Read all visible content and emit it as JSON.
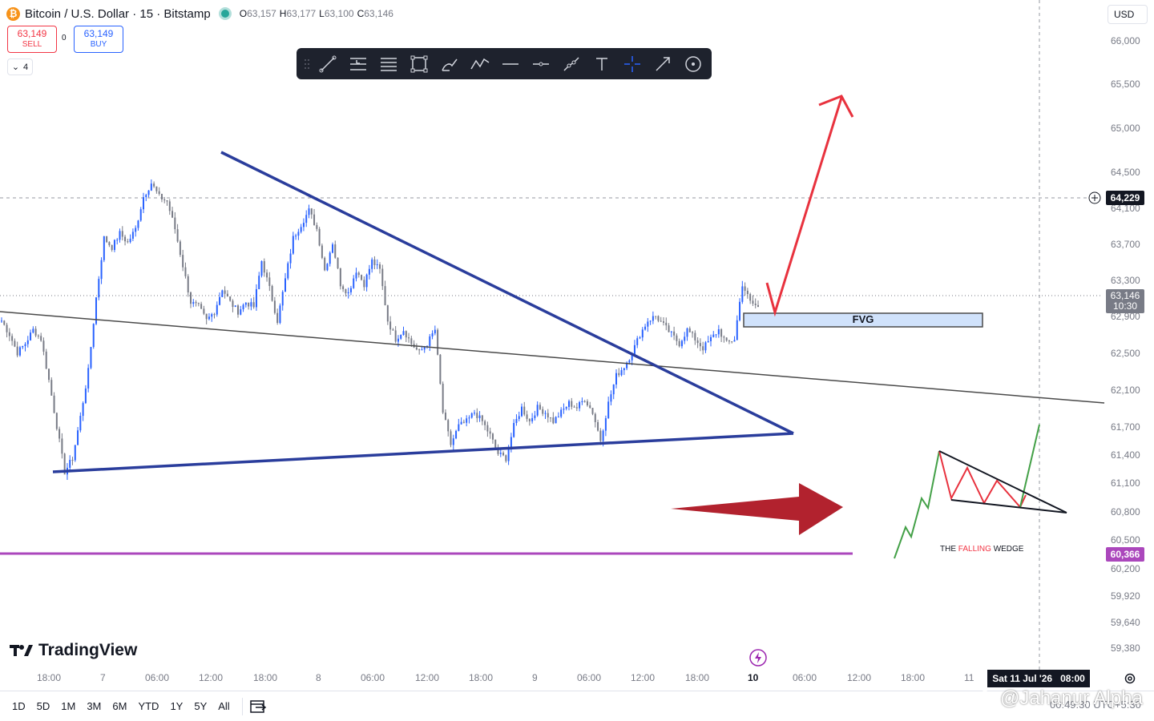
{
  "header": {
    "coin_glyph": "₿",
    "title": "Bitcoin / U.S. Dollar · 15 · Bitstamp",
    "ohlc": [
      {
        "key": "O",
        "value": "63,157"
      },
      {
        "key": "H",
        "value": "63,177"
      },
      {
        "key": "L",
        "value": "63,100"
      },
      {
        "key": "C",
        "value": "63,146"
      }
    ]
  },
  "trade": {
    "sell_price": "63,149",
    "sell_label": "SELL",
    "spread": "0",
    "buy_price": "63,149",
    "buy_label": "BUY"
  },
  "indicators_toggle": {
    "count": "4"
  },
  "toolbar": {
    "tools": [
      "trend-line",
      "long-position",
      "fib-levels",
      "rectangle",
      "brush",
      "path",
      "horizontal-line",
      "horizontal-ray",
      "polyline",
      "text",
      "crosshair",
      "arrow",
      "circle"
    ]
  },
  "currency": "USD",
  "price_axis": {
    "ticks": [
      "66,000",
      "65,500",
      "65,000",
      "64,500",
      "64,100",
      "63,700",
      "63,300",
      "62,900",
      "62,500",
      "62,100",
      "61,700",
      "61,400",
      "61,100",
      "60,800",
      "60,500",
      "60,200",
      "59,920",
      "59,640",
      "59,380"
    ],
    "crosshair_price": "64,229",
    "last_price": "63,146",
    "countdown": "10:30",
    "line_price": "60,366"
  },
  "time_axis": {
    "ticks": [
      "18:00",
      "7",
      "06:00",
      "12:00",
      "18:00",
      "8",
      "06:00",
      "12:00",
      "18:00",
      "9",
      "06:00",
      "12:00",
      "18:00",
      "10",
      "06:00",
      "12:00",
      "18:00",
      "11"
    ],
    "crosshair_date": "Sat 11 Jul '26",
    "crosshair_time": "08:00"
  },
  "annotations": {
    "fvg": "FVG",
    "wedge_title_1": "THE",
    "wedge_title_2": "FALLING",
    "wedge_title_3": "WEDGE"
  },
  "bottom_bar": {
    "ranges": [
      "1D",
      "5D",
      "1M",
      "3M",
      "6M",
      "YTD",
      "1Y",
      "5Y",
      "All"
    ],
    "clock": "00:49:30 UTC+5:30"
  },
  "branding": {
    "logo": "TradingView",
    "watermark": "@Jahanur Alpha"
  },
  "colors": {
    "up": "#2962ff",
    "down": "#787b86",
    "pattern_line": "#2a3d9c",
    "red_arrow": "#e8323e",
    "big_arrow": "#b2222e",
    "level_line": "#ab47bc",
    "fvg_fill": "#d0e2fb"
  },
  "chart_data": {
    "type": "candlestick",
    "symbol": "Bitcoin / U.S. Dollar",
    "interval": "15",
    "exchange": "Bitstamp",
    "ylim": [
      59380,
      66000
    ],
    "last_close": 63146,
    "key_levels": [
      60366,
      64229
    ],
    "close_path": [
      62950,
      62800,
      62600,
      62700,
      62850,
      62750,
      62300,
      61800,
      61300,
      61450,
      61900,
      62400,
      63200,
      63850,
      63750,
      63900,
      63800,
      63950,
      64300,
      64450,
      64300,
      64250,
      63950,
      63550,
      63150,
      63100,
      62950,
      63050,
      63300,
      63150,
      63050,
      63150,
      63100,
      63600,
      63300,
      62950,
      63400,
      63850,
      64000,
      64150,
      63950,
      63500,
      63800,
      63350,
      63250,
      63500,
      63350,
      63600,
      63500,
      62950,
      62750,
      62850,
      62700,
      62600,
      62700,
      62850,
      61950,
      61600,
      61800,
      61850,
      61950,
      61850,
      61700,
      61500,
      61450,
      61800,
      62000,
      61850,
      62000,
      61950,
      61850,
      61950,
      62050,
      62000,
      62100,
      61950,
      61650,
      62050,
      62350,
      62450,
      62600,
      62800,
      62950,
      63000,
      62900,
      62800,
      62700,
      62850,
      62750,
      62650,
      62750,
      62850,
      62700,
      62750,
      63350,
      63150,
      63100
    ]
  }
}
